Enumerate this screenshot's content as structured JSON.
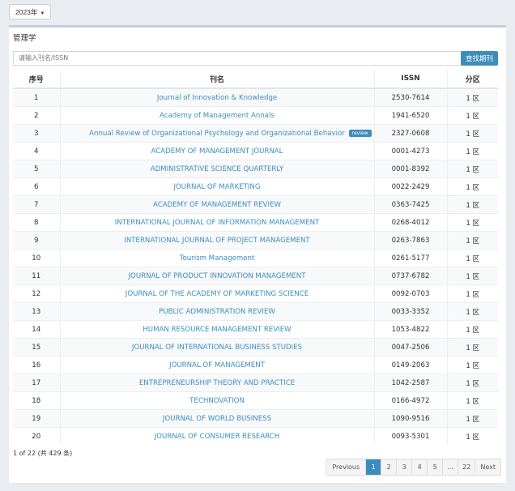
{
  "year_dropdown": {
    "label": "2023年"
  },
  "panel": {
    "subject": "管理学",
    "search": {
      "placeholder": "请输入刊名/ISSN",
      "button": "查找期刊"
    }
  },
  "table": {
    "headers": [
      "序号",
      "刊名",
      "ISSN",
      "分区"
    ],
    "rows": [
      {
        "num": "1",
        "title": "Journal of Innovation & Knowledge",
        "issn": "2530-7614",
        "zone": "1 区"
      },
      {
        "num": "2",
        "title": "Academy of Management Annals",
        "issn": "1941-6520",
        "zone": "1 区"
      },
      {
        "num": "3",
        "title": "Annual Review of Organizational Psychology and Organizational Behavior",
        "issn": "2327-0608",
        "zone": "1 区",
        "badge": "review"
      },
      {
        "num": "4",
        "title": "ACADEMY OF MANAGEMENT JOURNAL",
        "issn": "0001-4273",
        "zone": "1 区"
      },
      {
        "num": "5",
        "title": "ADMINISTRATIVE SCIENCE QUARTERLY",
        "issn": "0001-8392",
        "zone": "1 区"
      },
      {
        "num": "6",
        "title": "JOURNAL OF MARKETING",
        "issn": "0022-2429",
        "zone": "1 区"
      },
      {
        "num": "7",
        "title": "ACADEMY OF MANAGEMENT REVIEW",
        "issn": "0363-7425",
        "zone": "1 区"
      },
      {
        "num": "8",
        "title": "INTERNATIONAL JOURNAL OF INFORMATION MANAGEMENT",
        "issn": "0268-4012",
        "zone": "1 区"
      },
      {
        "num": "9",
        "title": "INTERNATIONAL JOURNAL OF PROJECT MANAGEMENT",
        "issn": "0263-7863",
        "zone": "1 区"
      },
      {
        "num": "10",
        "title": "Tourism Management",
        "issn": "0261-5177",
        "zone": "1 区"
      },
      {
        "num": "11",
        "title": "JOURNAL OF PRODUCT INNOVATION MANAGEMENT",
        "issn": "0737-6782",
        "zone": "1 区"
      },
      {
        "num": "12",
        "title": "JOURNAL OF THE ACADEMY OF MARKETING SCIENCE",
        "issn": "0092-0703",
        "zone": "1 区"
      },
      {
        "num": "13",
        "title": "PUBLIC ADMINISTRATION REVIEW",
        "issn": "0033-3352",
        "zone": "1 区"
      },
      {
        "num": "14",
        "title": "HUMAN RESOURCE MANAGEMENT REVIEW",
        "issn": "1053-4822",
        "zone": "1 区"
      },
      {
        "num": "15",
        "title": "JOURNAL OF INTERNATIONAL BUSINESS STUDIES",
        "issn": "0047-2506",
        "zone": "1 区"
      },
      {
        "num": "16",
        "title": "JOURNAL OF MANAGEMENT",
        "issn": "0149-2063",
        "zone": "1 区"
      },
      {
        "num": "17",
        "title": "ENTREPRENEURSHIP THEORY AND PRACTICE",
        "issn": "1042-2587",
        "zone": "1 区"
      },
      {
        "num": "18",
        "title": "TECHNOVATION",
        "issn": "0166-4972",
        "zone": "1 区"
      },
      {
        "num": "19",
        "title": "JOURNAL OF WORLD BUSINESS",
        "issn": "1090-9516",
        "zone": "1 区"
      },
      {
        "num": "20",
        "title": "JOURNAL OF CONSUMER RESEARCH",
        "issn": "0093-5301",
        "zone": "1 区"
      }
    ]
  },
  "footer": {
    "count": "1 of 22 (共 429 条)",
    "pagination": {
      "previous": "Previous",
      "pages": [
        "1",
        "2",
        "3",
        "4",
        "5",
        "…",
        "22"
      ],
      "next": "Next",
      "active_page": "1"
    }
  },
  "colors": {
    "accent": "#3c8dbc",
    "background": "#e9ecf1"
  }
}
